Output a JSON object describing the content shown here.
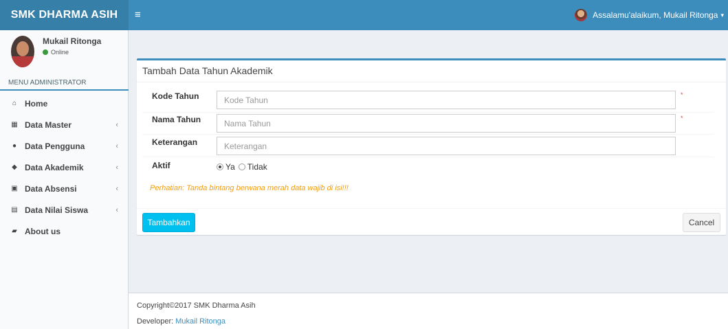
{
  "header": {
    "brand": "SMK DHARMA ASIH",
    "menu_toggle_glyph": "≡",
    "user_greeting": "Assalamu'alaikum, Mukail Ritonga",
    "caret_glyph": "▾"
  },
  "sidebar": {
    "user_name": "Mukail Ritonga",
    "user_status": "Online",
    "status_color": "#3c9a3c",
    "menu_header": "MENU ADMINISTRATOR",
    "items": [
      {
        "label": "Home",
        "icon": "home-icon",
        "glyph": "⌂",
        "has_arrow": false
      },
      {
        "label": "Data Master",
        "icon": "grid-icon",
        "glyph": "▦",
        "has_arrow": true
      },
      {
        "label": "Data Pengguna",
        "icon": "user-icon",
        "glyph": "●",
        "has_arrow": true
      },
      {
        "label": "Data Akademik",
        "icon": "tag-icon",
        "glyph": "◆",
        "has_arrow": true
      },
      {
        "label": "Data Absensi",
        "icon": "calendar-icon",
        "glyph": "▣",
        "has_arrow": true
      },
      {
        "label": "Data Nilai Siswa",
        "icon": "table-icon",
        "glyph": "▤",
        "has_arrow": true
      },
      {
        "label": "About us",
        "icon": "book-icon",
        "glyph": "▰",
        "has_arrow": false
      }
    ],
    "arrow_glyph": "‹"
  },
  "form": {
    "title": "Tambah Data Tahun Akademik",
    "fields": [
      {
        "label": "Kode Tahun",
        "placeholder": "Kode Tahun",
        "value": "",
        "required": true
      },
      {
        "label": "Nama Tahun",
        "placeholder": "Nama Tahun",
        "value": "",
        "required": true
      },
      {
        "label": "Keterangan",
        "placeholder": "Keterangan",
        "value": "",
        "required": false
      }
    ],
    "required_mark": "*",
    "aktif": {
      "label": "Aktif",
      "options": [
        "Ya",
        "Tidak"
      ],
      "selected": "Ya"
    },
    "warning": "Perhatian: Tanda bintang berwana merah data wajib di isi!!!",
    "submit_label": "Tambahkan",
    "cancel_label": "Cancel"
  },
  "footer": {
    "copyright": "Copyright©2017 SMK Dharma Asih",
    "developer_prefix": "Developer:",
    "developer_name": "Mukail Ritonga"
  },
  "colors": {
    "primary": "#3c8dbc",
    "logo_bg": "#367fa9",
    "button_info": "#00c0ef",
    "warning": "#f39c12",
    "required": "#dd4b39"
  }
}
